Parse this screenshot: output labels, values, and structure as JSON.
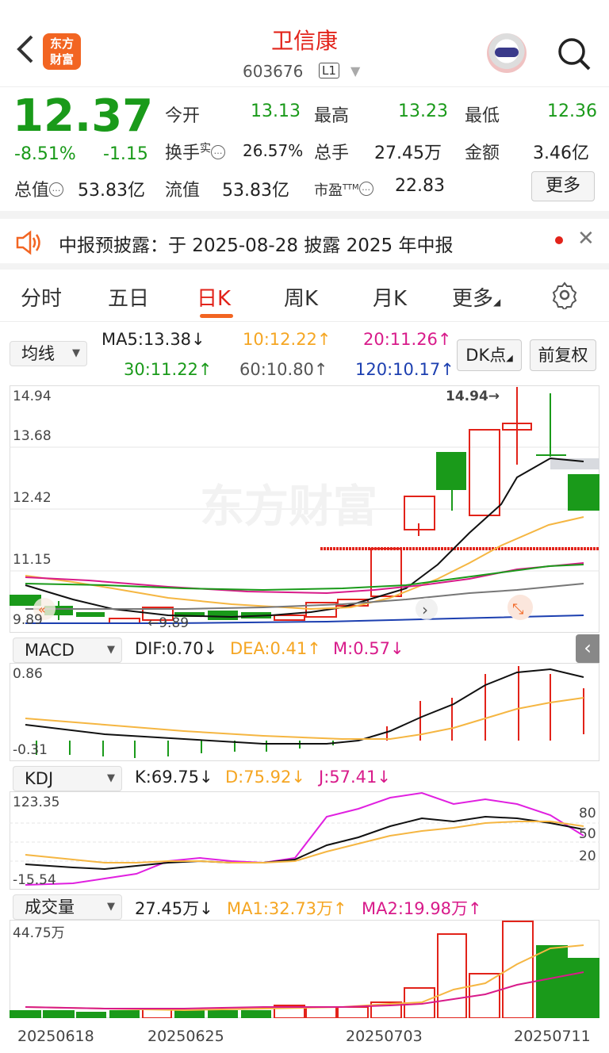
{
  "header": {
    "title": "卫信康",
    "code": "603676",
    "level": "L1",
    "logo_text": "东方财富"
  },
  "quote": {
    "price": "12.37",
    "change_pct": "-8.51%",
    "change": "-1.15",
    "open_label": "今开",
    "open": "13.13",
    "high_label": "最高",
    "high": "13.23",
    "low_label": "最低",
    "low": "12.36",
    "turnover_label": "换手",
    "turnover_sup": "实",
    "turnover": "26.57%",
    "volume_label": "总手",
    "volume": "27.45万",
    "amount_label": "金额",
    "amount": "3.46亿",
    "mktcap_label": "总值",
    "mktcap": "53.83亿",
    "float_label": "流值",
    "float": "53.83亿",
    "pe_label": "市盈",
    "pe_sup": "TTM",
    "pe": "22.83",
    "more_label": "更多"
  },
  "notice": {
    "text": "中报预披露：于 2025-08-28 披露 2025 年中报"
  },
  "tabs": [
    "分时",
    "五日",
    "日K",
    "周K",
    "月K",
    "更多"
  ],
  "active_tab": "日K",
  "ma_row": {
    "selector": "均线",
    "ma5": "MA5:13.38↓",
    "ma10": "10:12.22↑",
    "ma20": "20:11.26↑",
    "ma30": "30:11.22↑",
    "ma60": "60:10.80↑",
    "ma120": "120:10.17↑",
    "dk_label": "DK点",
    "fq_label": "前复权"
  },
  "kline": {
    "y_labels": [
      "14.94",
      "13.68",
      "12.42",
      "11.15",
      "9.89"
    ],
    "high_marker": "14.94→",
    "low_marker": "←9.89",
    "watermark": "东方财富"
  },
  "macd": {
    "selector": "MACD",
    "dif": "DIF:0.70↓",
    "dea": "DEA:0.41↑",
    "m": "M:0.57↓",
    "y_labels": [
      "0.86",
      "-0.31"
    ]
  },
  "kdj": {
    "selector": "KDJ",
    "k": "K:69.75↓",
    "d": "D:75.92↓",
    "j": "J:57.41↓",
    "y_labels": [
      "123.35",
      "-15.54"
    ],
    "right_labels": [
      "80",
      "50",
      "20"
    ]
  },
  "volume": {
    "selector": "成交量",
    "value": "27.45万↓",
    "ma1": "MA1:32.73万↑",
    "ma2": "MA2:19.98万↑",
    "y_label": "44.75万"
  },
  "dates": [
    "20250618",
    "20250625",
    "20250703",
    "20250711"
  ],
  "colors": {
    "up": "#e2231a",
    "down": "#1a9a1a",
    "accent": "#f26522"
  }
}
